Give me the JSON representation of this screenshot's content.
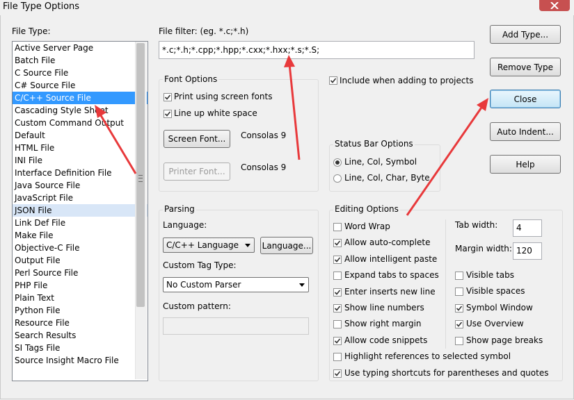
{
  "window": {
    "title": "File Type Options"
  },
  "file_type": {
    "label": "File Type:",
    "items": [
      {
        "label": "Active Server Page",
        "state": ""
      },
      {
        "label": "Batch File",
        "state": ""
      },
      {
        "label": "C Source File",
        "state": ""
      },
      {
        "label": "C# Source File",
        "state": ""
      },
      {
        "label": "C/C++ Source File",
        "state": "selected"
      },
      {
        "label": "Cascading Style Sheet",
        "state": ""
      },
      {
        "label": "Custom Command Output",
        "state": ""
      },
      {
        "label": "Default",
        "state": ""
      },
      {
        "label": "HTML File",
        "state": ""
      },
      {
        "label": "INI File",
        "state": ""
      },
      {
        "label": "Interface Definition File",
        "state": ""
      },
      {
        "label": "Java Source File",
        "state": ""
      },
      {
        "label": "JavaScript File",
        "state": ""
      },
      {
        "label": "JSON File",
        "state": "hover"
      },
      {
        "label": "Link Def File",
        "state": ""
      },
      {
        "label": "Make File",
        "state": ""
      },
      {
        "label": "Objective-C File",
        "state": ""
      },
      {
        "label": "Output File",
        "state": ""
      },
      {
        "label": "Perl Source File",
        "state": ""
      },
      {
        "label": "PHP File",
        "state": ""
      },
      {
        "label": "Plain Text",
        "state": ""
      },
      {
        "label": "Python File",
        "state": ""
      },
      {
        "label": "Resource File",
        "state": ""
      },
      {
        "label": "Search Results",
        "state": ""
      },
      {
        "label": "SI Tags File",
        "state": ""
      },
      {
        "label": "Source Insight Macro File",
        "state": ""
      }
    ]
  },
  "file_filter": {
    "label": "File filter: (eg. *.c;*.h)",
    "value": "*.c;*.h;*.cpp;*.hpp;*.cxx;*.hxx;*.s;*.S;"
  },
  "include_projects": {
    "label": "Include when adding to projects",
    "checked": true
  },
  "font_options": {
    "title": "Font Options",
    "print_screen_fonts": {
      "label": "Print using screen fonts",
      "checked": true
    },
    "line_up_whitespace": {
      "label": "Line up white space",
      "checked": true
    },
    "screen_font_button": "Screen Font...",
    "screen_font_value": "Consolas 9",
    "printer_font_button": "Printer Font...",
    "printer_font_value": "Consolas 9"
  },
  "status_bar": {
    "title": "Status Bar Options",
    "opt1": {
      "label": "Line, Col, Symbol",
      "selected": true
    },
    "opt2": {
      "label": "Line, Col, Char, Byte",
      "selected": false
    }
  },
  "parsing": {
    "title": "Parsing",
    "language_label": "Language:",
    "language_value": "C/C++ Language",
    "language_button": "Language...",
    "tag_type_label": "Custom Tag Type:",
    "tag_type_value": "No Custom Parser",
    "pattern_label": "Custom pattern:",
    "pattern_value": ""
  },
  "editing": {
    "title": "Editing Options",
    "left": [
      {
        "label": "Word Wrap",
        "checked": false
      },
      {
        "label": "Allow auto-complete",
        "checked": true
      },
      {
        "label": "Allow intelligent paste",
        "checked": true
      },
      {
        "label": "Expand tabs to spaces",
        "checked": false
      },
      {
        "label": "Enter inserts new line",
        "checked": true
      },
      {
        "label": "Show line numbers",
        "checked": true
      },
      {
        "label": "Show right margin",
        "checked": false
      },
      {
        "label": "Allow code snippets",
        "checked": true
      }
    ],
    "tab_width_label": "Tab width:",
    "tab_width_value": "4",
    "margin_width_label": "Margin width:",
    "margin_width_value": "120",
    "right": [
      {
        "label": "Visible tabs",
        "checked": false
      },
      {
        "label": "Visible spaces",
        "checked": false
      },
      {
        "label": "Symbol Window",
        "checked": true
      },
      {
        "label": "Use Overview",
        "checked": true
      },
      {
        "label": "Show page breaks",
        "checked": false
      }
    ],
    "highlight_refs": {
      "label": "Highlight references to selected symbol",
      "checked": false
    },
    "typing_shortcuts": {
      "label": "Use typing shortcuts for parentheses and quotes",
      "checked": true
    }
  },
  "buttons": {
    "add_type": "Add Type...",
    "remove_type": "Remove Type",
    "close": "Close",
    "auto_indent": "Auto Indent...",
    "help": "Help"
  },
  "annotation_color": "#e8393b"
}
